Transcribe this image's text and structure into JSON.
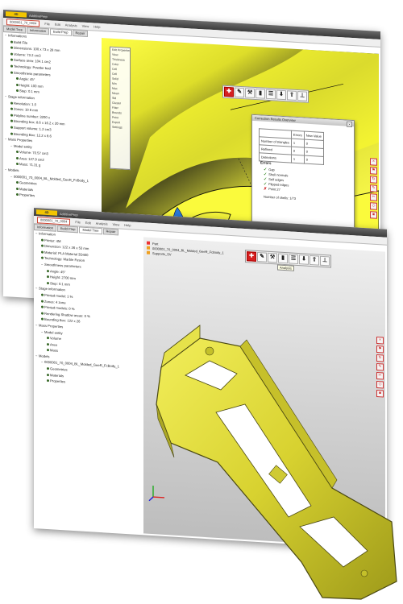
{
  "app": {
    "logo_text": "4D",
    "logo_subtext": "AdditivePrep",
    "menu": [
      "File",
      "Edit",
      "Analysis",
      "View",
      "Help"
    ]
  },
  "back_window": {
    "file_tab": "0000001_70_0004",
    "tabs": [
      "Model Tree",
      "Information",
      "Build Prep",
      "Repair"
    ],
    "tree": [
      {
        "t": "Informations",
        "lvl": 0,
        "tog": "−"
      },
      {
        "t": "Build File",
        "lvl": 1
      },
      {
        "t": "Dimensions: 100 x 73 x 28 mm",
        "lvl": 1
      },
      {
        "t": "Volume: 73.2 cm3",
        "lvl": 1
      },
      {
        "t": "Surface area: 104.1 cm2",
        "lvl": 1
      },
      {
        "t": "Technology: Powder bed",
        "lvl": 1
      },
      {
        "t": "Smoothness parameters",
        "lvl": 1
      },
      {
        "t": "Angle: 45°",
        "lvl": 2
      },
      {
        "t": "Height: 100 mm",
        "lvl": 2
      },
      {
        "t": "Step: 0.1 mm",
        "lvl": 2
      },
      {
        "t": "Stage information",
        "lvl": 0,
        "tog": "−"
      },
      {
        "t": "Resolution: 1.0",
        "lvl": 1
      },
      {
        "t": "Zones: 10 8 mm",
        "lvl": 1
      },
      {
        "t": "Polyline number: 3200 x",
        "lvl": 1
      },
      {
        "t": "Bounding box: 8.6 x 16.2 x 20 mm",
        "lvl": 1
      },
      {
        "t": "Support volume: 1.2 cm3",
        "lvl": 1
      },
      {
        "t": "Bounding Box: 12.2 x 8.6",
        "lvl": 1
      },
      {
        "t": "Mass Properties",
        "lvl": 0,
        "tog": "−"
      },
      {
        "t": "Model entity",
        "lvl": 1,
        "tog": "−"
      },
      {
        "t": "Volume: 70.57 cm3",
        "lvl": 2
      },
      {
        "t": "Area: 127.9 cm2",
        "lvl": 2
      },
      {
        "t": "Mass: 71.31 g",
        "lvl": 2
      },
      {
        "t": "Models",
        "lvl": 0,
        "tog": "−"
      },
      {
        "t": "0000001_70_0004_BL_Molded_GeeR_FcBody_1",
        "lvl": 1,
        "tog": "−"
      },
      {
        "t": "Geometries",
        "lvl": 2
      },
      {
        "t": "Materials",
        "lvl": 2
      },
      {
        "t": "Properties",
        "lvl": 2
      }
    ],
    "prop_panel": [
      "Edit Properties",
      "View",
      "Thickness",
      "Color",
      "Cell",
      "Cell",
      "Solid",
      "Min",
      "Max",
      "Mean",
      "Std",
      "Cluster",
      "Filter",
      "Bounds",
      "Point",
      "Export",
      "Settings"
    ],
    "dialog": {
      "title": "Correction Results Overview",
      "col_headers": [
        "",
        "Errors",
        "New Value"
      ],
      "rows": [
        [
          "Number of triangles",
          "1",
          "0"
        ],
        [
          "Refined",
          "0",
          "0"
        ],
        [
          "Detections",
          "1",
          "0"
        ]
      ],
      "section": "Errors",
      "checks": [
        {
          "label": "Gap",
          "ok": true
        },
        {
          "label": "Shell normals",
          "ok": true
        },
        {
          "label": "Self edges",
          "ok": true
        },
        {
          "label": "Flipped edges",
          "ok": true
        },
        {
          "label": "Point 27",
          "ok": false
        }
      ],
      "summary": "Number of shells: 1/73",
      "ok_button": "Close"
    }
  },
  "front_window": {
    "file_tab": "0000001_70_0004",
    "tabs": [
      "Information",
      "Build Prep",
      "Model Tree",
      "Repair"
    ],
    "tree": [
      {
        "t": "Information",
        "lvl": 0,
        "tog": "−"
      },
      {
        "t": "Printer: 4M",
        "lvl": 1
      },
      {
        "t": "Dimension: 122 x 26 x 53 mm",
        "lvl": 1
      },
      {
        "t": "Material: PLA Material 3D400",
        "lvl": 1
      },
      {
        "t": "Technology: Marble Fusion",
        "lvl": 1
      },
      {
        "t": "Smoothness parameters",
        "lvl": 1,
        "tog": "−"
      },
      {
        "t": "Angle: 45°",
        "lvl": 2
      },
      {
        "t": "Height: 2700 mm",
        "lvl": 2
      },
      {
        "t": "Step: 0.1 mm",
        "lvl": 2
      },
      {
        "t": "Stage information",
        "lvl": 0,
        "tog": "−"
      },
      {
        "t": "Printed model: 1 %",
        "lvl": 1
      },
      {
        "t": "Zones: 4 zone",
        "lvl": 1
      },
      {
        "t": "Printed models: 0 %",
        "lvl": 1
      },
      {
        "t": "Rendering Shadow areas: 0 %",
        "lvl": 1
      },
      {
        "t": "Bounding Box: 122 x 26",
        "lvl": 1
      },
      {
        "t": "Mass Properties",
        "lvl": 0,
        "tog": "−"
      },
      {
        "t": "Model entity",
        "lvl": 1,
        "tog": "−"
      },
      {
        "t": "Volume",
        "lvl": 2
      },
      {
        "t": "Area",
        "lvl": 2
      },
      {
        "t": "Mass",
        "lvl": 2
      },
      {
        "t": "Models",
        "lvl": 0,
        "tog": "−"
      },
      {
        "t": "0000001_70_0004_BL_Molded_GeeR_FcBody_1",
        "lvl": 1,
        "tog": "−"
      },
      {
        "t": "Geometries",
        "lvl": 2
      },
      {
        "t": "Materials",
        "lvl": 2
      },
      {
        "t": "Properties",
        "lvl": 2
      }
    ],
    "legend": [
      {
        "label": "Part",
        "color": "#e33"
      },
      {
        "label": "0000001_70_0004_BL_Molded_GeeR_FcBody_1",
        "color": "#f0a020"
      },
      {
        "label": "Supports_SV",
        "color": "#f0a020"
      }
    ],
    "tooltip": "Analysis"
  },
  "toolbar_icons": [
    "add-icon",
    "tool-icon",
    "wrench-icon",
    "chart-icon",
    "layers-icon",
    "download-icon",
    "export-icon",
    "pin-icon"
  ],
  "side_icons": [
    "close-icon",
    "flag-icon",
    "rotate-icon",
    "edit-icon",
    "cut-icon",
    "tag-icon",
    "lock-icon"
  ],
  "colors": {
    "accent": "#d52020",
    "model": "#e6e22a",
    "mesh_error": "#2a7ad8"
  }
}
